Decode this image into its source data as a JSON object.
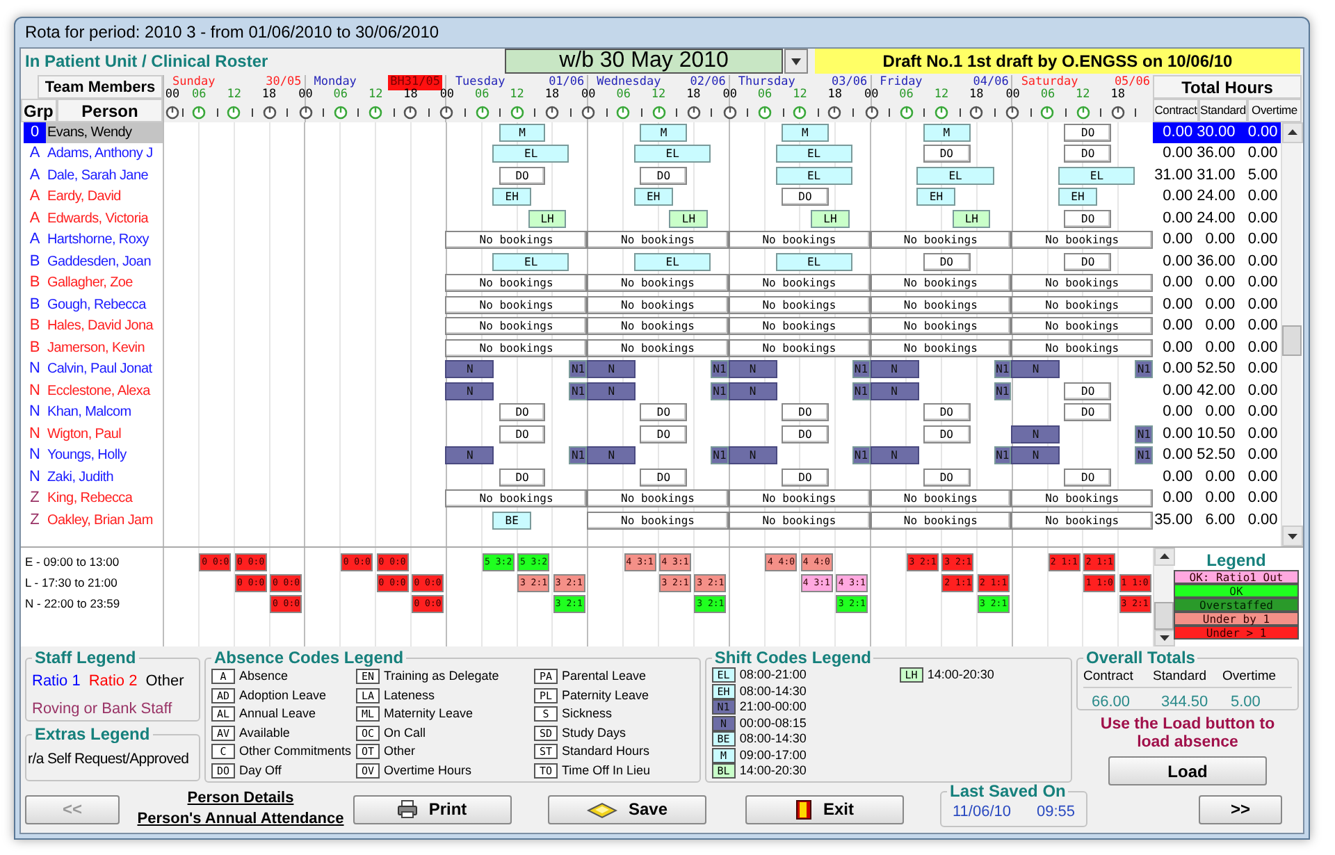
{
  "window": {
    "title": "Rota for period: 2010 3 - from 01/06/2010 to 30/06/2010"
  },
  "unit": "In Patient Unit / Clinical Roster",
  "week_selector": {
    "value": "w/b 30 May 2010"
  },
  "draft": "Draft No.1 1st draft by O.ENGSS on 10/06/10",
  "headers": {
    "team_members": "Team Members",
    "group": "Grp",
    "person": "Person",
    "total_hours": "Total Hours",
    "contract": "Contract",
    "standard": "Standard",
    "overtime": "Overtime"
  },
  "days": [
    {
      "name": "Sunday",
      "date": "30/05",
      "weekend": true,
      "holiday": false,
      "hours": [
        {
          "label": "00",
          "daytime": false
        },
        {
          "label": "06",
          "daytime": true
        },
        {
          "label": "12",
          "daytime": true
        },
        {
          "label": "18",
          "daytime": false
        }
      ]
    },
    {
      "name": "Monday",
      "date": "BH31/05",
      "weekend": false,
      "holiday": true,
      "hours": [
        {
          "label": "00",
          "daytime": false
        },
        {
          "label": "06",
          "daytime": true
        },
        {
          "label": "12",
          "daytime": true
        },
        {
          "label": "18",
          "daytime": false
        }
      ]
    },
    {
      "name": "Tuesday",
      "date": "01/06",
      "weekend": false,
      "holiday": false,
      "hours": [
        {
          "label": "00",
          "daytime": false
        },
        {
          "label": "06",
          "daytime": true
        },
        {
          "label": "12",
          "daytime": true
        },
        {
          "label": "18",
          "daytime": false
        }
      ]
    },
    {
      "name": "Wednesday",
      "date": "02/06",
      "weekend": false,
      "holiday": false,
      "hours": [
        {
          "label": "00",
          "daytime": false
        },
        {
          "label": "06",
          "daytime": true
        },
        {
          "label": "12",
          "daytime": true
        },
        {
          "label": "18",
          "daytime": false
        }
      ]
    },
    {
      "name": "Thursday",
      "date": "03/06",
      "weekend": false,
      "holiday": false,
      "hours": [
        {
          "label": "00",
          "daytime": false
        },
        {
          "label": "06",
          "daytime": true
        },
        {
          "label": "12",
          "daytime": true
        },
        {
          "label": "18",
          "daytime": false
        }
      ]
    },
    {
      "name": "Friday",
      "date": "04/06",
      "weekend": false,
      "holiday": false,
      "hours": [
        {
          "label": "00",
          "daytime": false
        },
        {
          "label": "06",
          "daytime": true
        },
        {
          "label": "12",
          "daytime": true
        },
        {
          "label": "18",
          "daytime": false
        }
      ]
    },
    {
      "name": "Saturday",
      "date": "05/06",
      "weekend": true,
      "holiday": false,
      "hours": [
        {
          "label": "00",
          "daytime": false
        },
        {
          "label": "06",
          "daytime": true
        },
        {
          "label": "12",
          "daytime": true
        },
        {
          "label": "18",
          "daytime": false
        }
      ]
    }
  ],
  "rows": [
    {
      "group": "0",
      "name": "Evans, Wendy",
      "selected": true,
      "contract": "0.00",
      "standard": "30.00",
      "overtime": "0.00",
      "days": [
        [
          {
            "text": "M",
            "kind": "m"
          }
        ],
        [
          {
            "text": "M",
            "kind": "m"
          }
        ],
        [
          {
            "text": "M",
            "kind": "m"
          }
        ],
        [
          {
            "text": "M",
            "kind": "m"
          }
        ],
        [
          {
            "text": "DO",
            "kind": "off"
          }
        ]
      ]
    },
    {
      "group": "A",
      "name": "Adams, Anthony J",
      "kind": "ratio1",
      "selected": false,
      "contract": "0.00",
      "standard": "36.00",
      "overtime": "0.00",
      "days": [
        [
          {
            "text": "EL",
            "kind": "long"
          }
        ],
        [
          {
            "text": "EL",
            "kind": "long"
          }
        ],
        [
          {
            "text": "EL",
            "kind": "long"
          }
        ],
        [
          {
            "text": "DO",
            "kind": "off"
          }
        ],
        [
          {
            "text": "DO",
            "kind": "off"
          }
        ]
      ]
    },
    {
      "group": "A",
      "name": "Dale, Sarah Jane",
      "kind": "ratio1",
      "selected": false,
      "contract": "31.00",
      "standard": "31.00",
      "overtime": "5.00",
      "days": [
        [
          {
            "text": "DO",
            "kind": "off"
          }
        ],
        [
          {
            "text": "DO",
            "kind": "off"
          }
        ],
        [
          {
            "text": "EL",
            "kind": "long"
          }
        ],
        [
          {
            "text": "EL",
            "kind": "long"
          }
        ],
        [
          {
            "text": "EL",
            "kind": "long"
          }
        ]
      ]
    },
    {
      "group": "A",
      "name": "Eardy, David",
      "kind": "ratio2",
      "selected": false,
      "contract": "0.00",
      "standard": "24.00",
      "overtime": "0.00",
      "days": [
        [
          {
            "text": "EH",
            "kind": "short"
          }
        ],
        [
          {
            "text": "EH",
            "kind": "short"
          }
        ],
        [
          {
            "text": "DO",
            "kind": "off"
          }
        ],
        [
          {
            "text": "EH",
            "kind": "short"
          }
        ],
        [
          {
            "text": "EH",
            "kind": "short"
          }
        ]
      ]
    },
    {
      "group": "A",
      "name": "Edwards, Victoria",
      "kind": "ratio2",
      "selected": false,
      "contract": "0.00",
      "standard": "24.00",
      "overtime": "0.00",
      "days": [
        [
          {
            "text": "LH",
            "kind": "late"
          }
        ],
        [
          {
            "text": "LH",
            "kind": "late"
          }
        ],
        [
          {
            "text": "LH",
            "kind": "late"
          }
        ],
        [
          {
            "text": "LH",
            "kind": "late"
          }
        ],
        [
          {
            "text": "DO",
            "kind": "off"
          }
        ]
      ]
    },
    {
      "group": "A",
      "name": "Hartshorne, Roxy",
      "kind": "ratio1",
      "selected": false,
      "contract": "0.00",
      "standard": "0.00",
      "overtime": "0.00",
      "days": [
        [
          {
            "text": "No bookings",
            "kind": "none"
          }
        ],
        [
          {
            "text": "No bookings",
            "kind": "none"
          }
        ],
        [
          {
            "text": "No bookings",
            "kind": "none"
          }
        ],
        [
          {
            "text": "No bookings",
            "kind": "none"
          }
        ],
        [
          {
            "text": "No bookings",
            "kind": "none"
          }
        ]
      ]
    },
    {
      "group": "B",
      "name": "Gaddesden, Joan",
      "kind": "ratio1",
      "selected": false,
      "contract": "0.00",
      "standard": "36.00",
      "overtime": "0.00",
      "days": [
        [
          {
            "text": "EL",
            "kind": "long"
          }
        ],
        [
          {
            "text": "EL",
            "kind": "long"
          }
        ],
        [
          {
            "text": "EL",
            "kind": "long"
          }
        ],
        [
          {
            "text": "DO",
            "kind": "off"
          }
        ],
        [
          {
            "text": "DO",
            "kind": "off"
          }
        ]
      ]
    },
    {
      "group": "B",
      "name": "Gallagher, Zoe",
      "kind": "ratio2",
      "selected": false,
      "contract": "0.00",
      "standard": "0.00",
      "overtime": "0.00",
      "days": [
        [
          {
            "text": "No bookings",
            "kind": "none"
          }
        ],
        [
          {
            "text": "No bookings",
            "kind": "none"
          }
        ],
        [
          {
            "text": "No bookings",
            "kind": "none"
          }
        ],
        [
          {
            "text": "No bookings",
            "kind": "none"
          }
        ],
        [
          {
            "text": "No bookings",
            "kind": "none"
          }
        ]
      ]
    },
    {
      "group": "B",
      "name": "Gough, Rebecca",
      "kind": "ratio1",
      "selected": false,
      "contract": "0.00",
      "standard": "0.00",
      "overtime": "0.00",
      "days": [
        [
          {
            "text": "No bookings",
            "kind": "none"
          }
        ],
        [
          {
            "text": "No bookings",
            "kind": "none"
          }
        ],
        [
          {
            "text": "No bookings",
            "kind": "none"
          }
        ],
        [
          {
            "text": "No bookings",
            "kind": "none"
          }
        ],
        [
          {
            "text": "No bookings",
            "kind": "none"
          }
        ]
      ]
    },
    {
      "group": "B",
      "name": "Hales, David Jona",
      "kind": "ratio2",
      "selected": false,
      "contract": "0.00",
      "standard": "0.00",
      "overtime": "0.00",
      "days": [
        [
          {
            "text": "No bookings",
            "kind": "none"
          }
        ],
        [
          {
            "text": "No bookings",
            "kind": "none"
          }
        ],
        [
          {
            "text": "No bookings",
            "kind": "none"
          }
        ],
        [
          {
            "text": "No bookings",
            "kind": "none"
          }
        ],
        [
          {
            "text": "No bookings",
            "kind": "none"
          }
        ]
      ]
    },
    {
      "group": "B",
      "name": "Jamerson, Kevin",
      "kind": "ratio2",
      "selected": false,
      "contract": "0.00",
      "standard": "0.00",
      "overtime": "0.00",
      "days": [
        [
          {
            "text": "No bookings",
            "kind": "none"
          }
        ],
        [
          {
            "text": "No bookings",
            "kind": "none"
          }
        ],
        [
          {
            "text": "No bookings",
            "kind": "none"
          }
        ],
        [
          {
            "text": "No bookings",
            "kind": "none"
          }
        ],
        [
          {
            "text": "No bookings",
            "kind": "none"
          }
        ]
      ]
    },
    {
      "group": "N",
      "name": "Calvin, Paul Jonat",
      "kind": "ratio1",
      "selected": false,
      "contract": "0.00",
      "standard": "52.50",
      "overtime": "0.00",
      "days": [
        [
          {
            "text": "N",
            "kind": "night"
          },
          {
            "text": "N1",
            "kind": "night_start"
          }
        ],
        [
          {
            "text": "N",
            "kind": "night"
          },
          {
            "text": "N1",
            "kind": "night_start"
          }
        ],
        [
          {
            "text": "N",
            "kind": "night"
          },
          {
            "text": "N1",
            "kind": "night_start"
          }
        ],
        [
          {
            "text": "N",
            "kind": "night"
          },
          {
            "text": "N1",
            "kind": "night_start"
          }
        ],
        [
          {
            "text": "N",
            "kind": "night"
          },
          {
            "text": "N1",
            "kind": "night_start"
          }
        ]
      ]
    },
    {
      "group": "N",
      "name": "Ecclestone, Alexa",
      "kind": "ratio2",
      "selected": false,
      "contract": "0.00",
      "standard": "42.00",
      "overtime": "0.00",
      "days": [
        [
          {
            "text": "N",
            "kind": "night"
          },
          {
            "text": "N1",
            "kind": "night_start"
          }
        ],
        [
          {
            "text": "N",
            "kind": "night"
          },
          {
            "text": "N1",
            "kind": "night_start"
          }
        ],
        [
          {
            "text": "N",
            "kind": "night"
          },
          {
            "text": "N1",
            "kind": "night_start"
          }
        ],
        [
          {
            "text": "N",
            "kind": "night"
          },
          {
            "text": "N1",
            "kind": "night_start"
          }
        ],
        [
          {
            "text": "DO",
            "kind": "off"
          }
        ]
      ]
    },
    {
      "group": "N",
      "name": "Khan, Malcom",
      "kind": "ratio1",
      "selected": false,
      "contract": "0.00",
      "standard": "0.00",
      "overtime": "0.00",
      "days": [
        [
          {
            "text": "DO",
            "kind": "off"
          }
        ],
        [
          {
            "text": "DO",
            "kind": "off"
          }
        ],
        [
          {
            "text": "DO",
            "kind": "off"
          }
        ],
        [
          {
            "text": "DO",
            "kind": "off"
          }
        ],
        [
          {
            "text": "DO",
            "kind": "off"
          }
        ]
      ]
    },
    {
      "group": "N",
      "name": "Wigton, Paul",
      "kind": "ratio2",
      "selected": false,
      "contract": "0.00",
      "standard": "10.50",
      "overtime": "0.00",
      "days": [
        [
          {
            "text": "DO",
            "kind": "off"
          }
        ],
        [
          {
            "text": "DO",
            "kind": "off"
          }
        ],
        [
          {
            "text": "DO",
            "kind": "off"
          }
        ],
        [
          {
            "text": "DO",
            "kind": "off"
          }
        ],
        [
          {
            "text": "N",
            "kind": "night"
          },
          {
            "text": "N1",
            "kind": "night_start"
          }
        ]
      ]
    },
    {
      "group": "N",
      "name": "Youngs, Holly",
      "kind": "ratio1",
      "selected": false,
      "contract": "0.00",
      "standard": "52.50",
      "overtime": "0.00",
      "days": [
        [
          {
            "text": "N",
            "kind": "night"
          },
          {
            "text": "N1",
            "kind": "night_start"
          }
        ],
        [
          {
            "text": "N",
            "kind": "night"
          },
          {
            "text": "N1",
            "kind": "night_start"
          }
        ],
        [
          {
            "text": "N",
            "kind": "night"
          },
          {
            "text": "N1",
            "kind": "night_start"
          }
        ],
        [
          {
            "text": "N",
            "kind": "night"
          },
          {
            "text": "N1",
            "kind": "night_start"
          }
        ],
        [
          {
            "text": "N",
            "kind": "night"
          },
          {
            "text": "N1",
            "kind": "night_start"
          }
        ]
      ]
    },
    {
      "group": "N",
      "name": "Zaki, Judith",
      "kind": "ratio1",
      "selected": false,
      "contract": "0.00",
      "standard": "0.00",
      "overtime": "0.00",
      "days": [
        [
          {
            "text": "DO",
            "kind": "off"
          }
        ],
        [
          {
            "text": "DO",
            "kind": "off"
          }
        ],
        [
          {
            "text": "DO",
            "kind": "off"
          }
        ],
        [
          {
            "text": "DO",
            "kind": "off"
          }
        ],
        [
          {
            "text": "DO",
            "kind": "off"
          }
        ]
      ]
    },
    {
      "group": "Z",
      "name": "King, Rebecca",
      "kind": "bank",
      "selected": false,
      "contract": "0.00",
      "standard": "0.00",
      "overtime": "0.00",
      "days": [
        [
          {
            "text": "No bookings",
            "kind": "none"
          }
        ],
        [
          {
            "text": "No bookings",
            "kind": "none"
          }
        ],
        [
          {
            "text": "No bookings",
            "kind": "none"
          }
        ],
        [
          {
            "text": "No bookings",
            "kind": "none"
          }
        ],
        [
          {
            "text": "No bookings",
            "kind": "none"
          }
        ]
      ]
    },
    {
      "group": "Z",
      "name": "Oakley, Brian Jam",
      "kind": "bank",
      "selected": false,
      "contract": "35.00",
      "standard": "6.00",
      "overtime": "0.00",
      "days": [
        [
          {
            "text": "BE",
            "kind": "short"
          }
        ],
        [
          {
            "text": "No bookings",
            "kind": "none"
          }
        ],
        [
          {
            "text": "No bookings",
            "kind": "none"
          }
        ],
        [
          {
            "text": "No bookings",
            "kind": "none"
          }
        ],
        [
          {
            "text": "No bookings",
            "kind": "none"
          }
        ]
      ]
    }
  ],
  "coverage": [
    {
      "label": "E - 09:00 to 13:00",
      "cells": [
        {
          "text": "0 0:0",
          "kind": "under_more"
        },
        {
          "text": "0 0:0",
          "kind": "under_more"
        },
        {
          "text": "0 0:0",
          "kind": "under_more"
        },
        {
          "text": "0 0:0",
          "kind": "under_more"
        },
        {
          "text": "5 3:2",
          "kind": "ok"
        },
        {
          "text": "5 3:2",
          "kind": "ok"
        },
        {
          "text": "4 3:1",
          "kind": "under1"
        },
        {
          "text": "4 3:1",
          "kind": "under1"
        },
        {
          "text": "4 4:0",
          "kind": "under1"
        },
        {
          "text": "4 4:0",
          "kind": "under1"
        },
        {
          "text": "3 2:1",
          "kind": "under_more"
        },
        {
          "text": "3 2:1",
          "kind": "under_more"
        },
        {
          "text": "2 1:1",
          "kind": "under_more"
        },
        {
          "text": "2 1:1",
          "kind": "under_more"
        }
      ]
    },
    {
      "label": "L - 17:30 to 21:00",
      "cells": [
        {
          "text": "0 0:0",
          "kind": "under_more"
        },
        {
          "text": "0 0:0",
          "kind": "under_more"
        },
        {
          "text": "0 0:0",
          "kind": "under_more"
        },
        {
          "text": "0 0:0",
          "kind": "under_more"
        },
        {
          "text": "3 2:1",
          "kind": "under1"
        },
        {
          "text": "3 2:1",
          "kind": "under1"
        },
        {
          "text": "3 2:1",
          "kind": "under1"
        },
        {
          "text": "3 2:1",
          "kind": "under1"
        },
        {
          "text": "4 3:1",
          "kind": "ratio1_out"
        },
        {
          "text": "4 3:1",
          "kind": "ratio1_out"
        },
        {
          "text": "2 1:1",
          "kind": "under_more"
        },
        {
          "text": "2 1:1",
          "kind": "under_more"
        },
        {
          "text": "1 1:0",
          "kind": "under_more"
        },
        {
          "text": "1 1:0",
          "kind": "under_more"
        }
      ]
    },
    {
      "label": "N - 22:00 to 23:59",
      "cells": [
        {
          "text": "0 0:0",
          "kind": "under_more"
        },
        {
          "text": "0 0:0",
          "kind": "under_more"
        },
        {
          "text": "3 2:1",
          "kind": "ok"
        },
        {
          "text": "3 2:1",
          "kind": "ok"
        },
        {
          "text": "3 2:1",
          "kind": "ok"
        },
        {
          "text": "3 2:1",
          "kind": "ok"
        },
        {
          "text": "3 2:1",
          "kind": "under_more"
        }
      ]
    }
  ],
  "legend": {
    "title": "Legend",
    "items": [
      {
        "text": "OK: Ratio1 Out",
        "kind": "ratio1_out"
      },
      {
        "text": "OK",
        "kind": "ok"
      },
      {
        "text": "Overstaffed",
        "kind": "overstaffed"
      },
      {
        "text": "Under by 1",
        "kind": "under1"
      },
      {
        "text": "Under > 1",
        "kind": "under_more"
      }
    ]
  },
  "staff_legend": {
    "title": "Staff Legend",
    "items": [
      {
        "text": "Ratio 1",
        "color": "#0000ff"
      },
      {
        "text": "Ratio 2",
        "color": "#ff0000"
      },
      {
        "text": "Other",
        "color": "#000000"
      },
      {
        "text": "Roving or Bank Staff",
        "color": "#993366"
      }
    ]
  },
  "extras_legend": {
    "title": "Extras Legend",
    "items": [
      "r/a Self Request/Approved"
    ]
  },
  "absence_legend": {
    "title": "Absence Codes Legend",
    "items": [
      {
        "code": "A",
        "text": "Absence"
      },
      {
        "code": "AD",
        "text": "Adoption Leave"
      },
      {
        "code": "AL",
        "text": "Annual Leave"
      },
      {
        "code": "AV",
        "text": "Available"
      },
      {
        "code": "C",
        "text": "Other Commitments"
      },
      {
        "code": "DO",
        "text": "Day Off"
      },
      {
        "code": "EN",
        "text": "Training as Delegate"
      },
      {
        "code": "LA",
        "text": "Lateness"
      },
      {
        "code": "ML",
        "text": "Maternity Leave"
      },
      {
        "code": "OC",
        "text": "On Call"
      },
      {
        "code": "OT",
        "text": "Other"
      },
      {
        "code": "OV",
        "text": "Overtime Hours"
      },
      {
        "code": "PA",
        "text": "Parental Leave"
      },
      {
        "code": "PL",
        "text": "Paternity Leave"
      },
      {
        "code": "S",
        "text": "Sickness"
      },
      {
        "code": "SD",
        "text": "Study Days"
      },
      {
        "code": "ST",
        "text": "Standard Hours"
      },
      {
        "code": "TO",
        "text": "Time Off In Lieu"
      }
    ]
  },
  "shift_legend": {
    "title": "Shift Codes Legend",
    "items": [
      {
        "code": "EL",
        "text": "08:00-21:00",
        "kind": "long"
      },
      {
        "code": "EH",
        "text": "08:00-14:30",
        "kind": "short"
      },
      {
        "code": "N1",
        "text": "21:00-00:00",
        "kind": "night_start"
      },
      {
        "code": "N",
        "text": "00:00-08:15",
        "kind": "night"
      },
      {
        "code": "BE",
        "text": "08:00-14:30",
        "kind": "short"
      },
      {
        "code": "M",
        "text": "09:00-17:00",
        "kind": "m"
      },
      {
        "code": "BL",
        "text": "14:00-20:30",
        "kind": "late"
      },
      {
        "code": "LH",
        "text": "14:00-20:30",
        "kind": "late"
      }
    ]
  },
  "overall_totals": {
    "title": "Overall Totals",
    "columns": [
      "Contract",
      "Standard",
      "Overtime"
    ],
    "values": [
      "66.00",
      "344.50",
      "5.00"
    ]
  },
  "load": {
    "hint": "Use the Load button to load absence",
    "button": "Load"
  },
  "footer": {
    "prev": {
      "label": "<<",
      "disabled": true
    },
    "links": [
      "Person Details",
      "Person's Annual Attendance"
    ],
    "buttons": [
      {
        "label": "Print",
        "kind": "print"
      },
      {
        "label": "Save",
        "kind": "save"
      },
      {
        "label": "Exit",
        "kind": "exit"
      }
    ],
    "last_saved": {
      "title": "Last Saved On",
      "date": "11/06/10",
      "time": "09:55"
    },
    "next": {
      "label": ">>",
      "disabled": false
    }
  }
}
